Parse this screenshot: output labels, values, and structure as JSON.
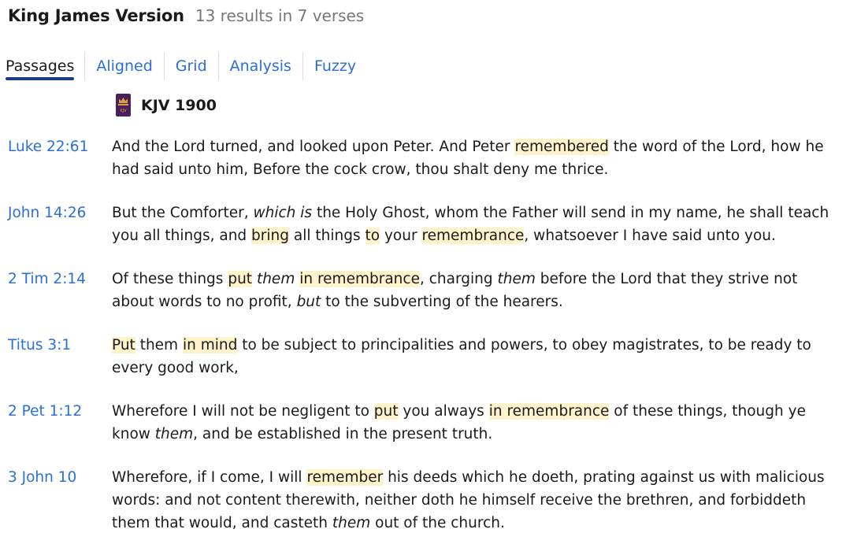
{
  "header": {
    "title": "King James Version",
    "count": "13 results in 7 verses"
  },
  "tabs": [
    {
      "label": "Passages",
      "active": true
    },
    {
      "label": "Aligned",
      "active": false
    },
    {
      "label": "Grid",
      "active": false
    },
    {
      "label": "Analysis",
      "active": false
    },
    {
      "label": "Fuzzy",
      "active": false
    }
  ],
  "version": {
    "icon": "kjv-book-cover-icon",
    "icon_text": "KJV",
    "label": "KJV 1900"
  },
  "colors": {
    "link": "#2b6fd6",
    "highlight": "#fff3cc",
    "tab_underline": "#1c3a8a"
  },
  "verses": [
    {
      "ref": "Luke 22:61",
      "segments": [
        {
          "t": "And the Lord turned, and looked upon Peter. And Peter "
        },
        {
          "t": "remembered",
          "hl": true
        },
        {
          "t": " the word of the Lord, how he had said unto him, Before the cock crow, thou shalt deny me thrice."
        }
      ]
    },
    {
      "ref": "John 14:26",
      "segments": [
        {
          "t": "But the Comforter, "
        },
        {
          "t": "which is",
          "it": true
        },
        {
          "t": " the Holy Ghost, whom the Father will send in my name, he shall teach you all things, and "
        },
        {
          "t": "bring",
          "hl": true
        },
        {
          "t": " all things "
        },
        {
          "t": "to",
          "hl": true
        },
        {
          "t": " your "
        },
        {
          "t": "remembrance",
          "hl": true
        },
        {
          "t": ", whatsoever I have said unto you."
        }
      ]
    },
    {
      "ref": "2 Tim 2:14",
      "segments": [
        {
          "t": "Of these things "
        },
        {
          "t": "put",
          "hl": true
        },
        {
          "t": " "
        },
        {
          "t": "them",
          "it": true
        },
        {
          "t": " "
        },
        {
          "t": "in remembrance",
          "hl": true
        },
        {
          "t": ", charging "
        },
        {
          "t": "them",
          "it": true
        },
        {
          "t": " before the Lord that they strive not about words to no profit, "
        },
        {
          "t": "but",
          "it": true
        },
        {
          "t": " to the subverting of the hearers."
        }
      ]
    },
    {
      "ref": "Titus 3:1",
      "segments": [
        {
          "t": "Put",
          "hl": true
        },
        {
          "t": " them "
        },
        {
          "t": "in mind",
          "hl": true
        },
        {
          "t": " to be subject to principalities and powers, to obey magistrates, to be ready to every good work,"
        }
      ]
    },
    {
      "ref": "2 Pet 1:12",
      "segments": [
        {
          "t": "Wherefore I will not be negligent to "
        },
        {
          "t": "put",
          "hl": true
        },
        {
          "t": " you always "
        },
        {
          "t": "in remembrance",
          "hl": true
        },
        {
          "t": " of these things, though ye know "
        },
        {
          "t": "them",
          "it": true
        },
        {
          "t": ", and be established in the present truth."
        }
      ]
    },
    {
      "ref": "3 John 10",
      "segments": [
        {
          "t": "Wherefore, if I come, I will "
        },
        {
          "t": "remember",
          "hl": true
        },
        {
          "t": " his deeds which he doeth, prating against us with malicious words: and not content therewith, neither doth he himself receive the brethren, and forbiddeth them that would, and casteth "
        },
        {
          "t": "them",
          "it": true
        },
        {
          "t": " out of the church."
        }
      ]
    }
  ]
}
